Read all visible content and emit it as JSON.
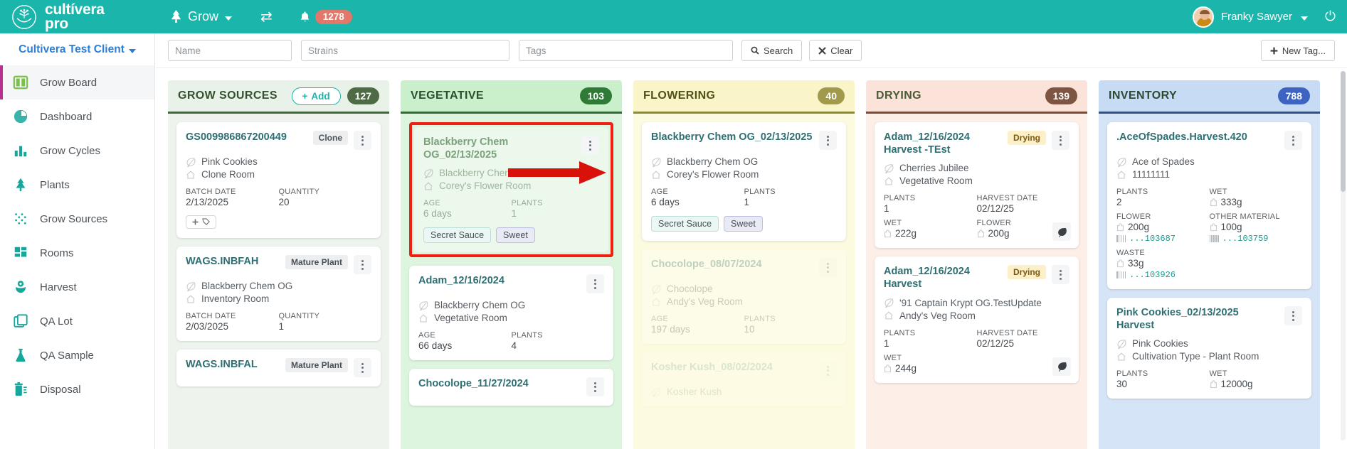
{
  "topbar": {
    "brand_line1": "cultívera",
    "brand_line2": "pro",
    "nav_label": "Grow",
    "notification_count": "1278",
    "user_name": "Franky Sawyer",
    "icons": {
      "tree": "tree-icon",
      "swap": "swap-icon",
      "bell": "bell-icon",
      "power": "power-icon"
    }
  },
  "sidebar": {
    "client": "Cultivera Test Client",
    "items": [
      {
        "label": "Grow Board",
        "icon": "grow-board-icon",
        "active": true
      },
      {
        "label": "Dashboard",
        "icon": "pie-chart-icon",
        "active": false
      },
      {
        "label": "Grow Cycles",
        "icon": "bar-chart-icon",
        "active": false
      },
      {
        "label": "Plants",
        "icon": "tree-icon",
        "active": false
      },
      {
        "label": "Grow Sources",
        "icon": "dots-grid-icon",
        "active": false
      },
      {
        "label": "Rooms",
        "icon": "rooms-grid-icon",
        "active": false
      },
      {
        "label": "Harvest",
        "icon": "flower-icon",
        "active": false
      },
      {
        "label": "QA Lot",
        "icon": "layers-icon",
        "active": false
      },
      {
        "label": "QA Sample",
        "icon": "flask-icon",
        "active": false
      },
      {
        "label": "Disposal",
        "icon": "trash-icon",
        "active": false
      }
    ]
  },
  "filterbar": {
    "name_placeholder": "Name",
    "name_value": "",
    "strains_placeholder": "Strains",
    "strains_value": "",
    "tags_placeholder": "Tags",
    "tags_value": "",
    "search_label": "Search",
    "clear_label": "Clear",
    "new_tag_label": "New Tag..."
  },
  "board": {
    "columns": [
      {
        "title": "GROW SOURCES",
        "count": "127",
        "add_label": "Add",
        "cards": [
          {
            "title": "GS009986867200449",
            "chip": "Clone",
            "strain": "Pink Cookies",
            "room": "Clone Room",
            "fields": [
              {
                "label": "BATCH DATE",
                "value": "2/13/2025"
              },
              {
                "label": "QUANTITY",
                "value": "20"
              }
            ],
            "add_tag": true
          },
          {
            "title": "WAGS.INBFAH",
            "chip": "Mature Plant",
            "strain": "Blackberry Chem OG",
            "room": "Inventory Room",
            "fields": [
              {
                "label": "BATCH DATE",
                "value": "2/03/2025"
              },
              {
                "label": "QUANTITY",
                "value": "1"
              }
            ]
          },
          {
            "title": "WAGS.INBFAL",
            "chip": "Mature Plant",
            "strain": "",
            "room": "",
            "fields": []
          }
        ]
      },
      {
        "title": "VEGETATIVE",
        "count": "103",
        "cards": [
          {
            "title": "Blackberry Chem OG_02/13/2025",
            "strain": "Blackberry Chem OG",
            "room": "Corey's Flower Room",
            "selected": true,
            "fields": [
              {
                "label": "AGE",
                "value": "6 days"
              },
              {
                "label": "PLANTS",
                "value": "1"
              }
            ],
            "tags": [
              "Secret Sauce",
              "Sweet"
            ]
          },
          {
            "title": "Adam_12/16/2024",
            "strain": "Blackberry Chem OG",
            "room": "Vegetative Room",
            "fields": [
              {
                "label": "AGE",
                "value": "66 days"
              },
              {
                "label": "PLANTS",
                "value": "4"
              }
            ]
          },
          {
            "title": "Chocolope_11/27/2024",
            "strain": "",
            "room": "",
            "fields": []
          }
        ]
      },
      {
        "title": "FLOWERING",
        "count": "40",
        "cards": [
          {
            "title": "Blackberry Chem OG_02/13/2025",
            "strain": "Blackberry Chem OG",
            "room": "Corey's Flower Room",
            "fields": [
              {
                "label": "AGE",
                "value": "6 days"
              },
              {
                "label": "PLANTS",
                "value": "1"
              }
            ],
            "tags": [
              "Secret Sauce",
              "Sweet"
            ]
          },
          {
            "title": "Chocolope_08/07/2024",
            "strain": "Chocolope",
            "room": "Andy's Veg Room",
            "faded": true,
            "fields": [
              {
                "label": "AGE",
                "value": "197 days"
              },
              {
                "label": "PLANTS",
                "value": "10"
              }
            ]
          },
          {
            "title": "Kosher Kush_08/02/2024",
            "strain": "Kosher Kush",
            "room": "",
            "faded2": true,
            "fields": []
          }
        ]
      },
      {
        "title": "DRYING",
        "count": "139",
        "cards": [
          {
            "title": "Adam_12/16/2024 Harvest -TEst",
            "chip": "Drying",
            "strain": "Cherries Jubilee",
            "room": "Vegetative Room",
            "fields": [
              {
                "label": "PLANTS",
                "value": "1"
              },
              {
                "label": "HARVEST DATE",
                "value": "02/12/25"
              },
              {
                "label": "WET",
                "value": "222g",
                "bag": true
              },
              {
                "label": "FLOWER",
                "value": "200g",
                "bag": true
              }
            ],
            "leaf_badge": true
          },
          {
            "title": "Adam_12/16/2024 Harvest",
            "chip": "Drying",
            "strain": "'91 Captain Krypt OG.TestUpdate",
            "room": "Andy's Veg Room",
            "fields": [
              {
                "label": "PLANTS",
                "value": "1"
              },
              {
                "label": "HARVEST DATE",
                "value": "02/12/25"
              },
              {
                "label": "WET",
                "value": "244g",
                "bag": true
              }
            ],
            "leaf_badge": true
          }
        ]
      },
      {
        "title": "INVENTORY",
        "count": "788",
        "cards": [
          {
            "title": ".AceOfSpades.Harvest.420",
            "strain": "Ace of Spades",
            "room": "11111111",
            "fields": [
              {
                "label": "PLANTS",
                "value": "2"
              },
              {
                "label": "WET",
                "value": "333g",
                "bag": true
              },
              {
                "label": "FLOWER",
                "value": "200g",
                "bag": true,
                "tag": "...103687"
              },
              {
                "label": "OTHER MATERIAL",
                "value": "100g",
                "bag": true,
                "tag": "...103759"
              },
              {
                "label": "WASTE",
                "value": "33g",
                "bag": true,
                "tag": "...103926"
              }
            ]
          },
          {
            "title": "Pink Cookies_02/13/2025 Harvest",
            "strain": "Pink Cookies",
            "room": "Cultivation Type - Plant Room",
            "fields": [
              {
                "label": "PLANTS",
                "value": "30"
              },
              {
                "label": "WET",
                "value": "12000g",
                "bag": true
              }
            ]
          }
        ]
      }
    ]
  },
  "annotation": {
    "arrow": "red-right-arrow",
    "color": "#d8120b"
  }
}
